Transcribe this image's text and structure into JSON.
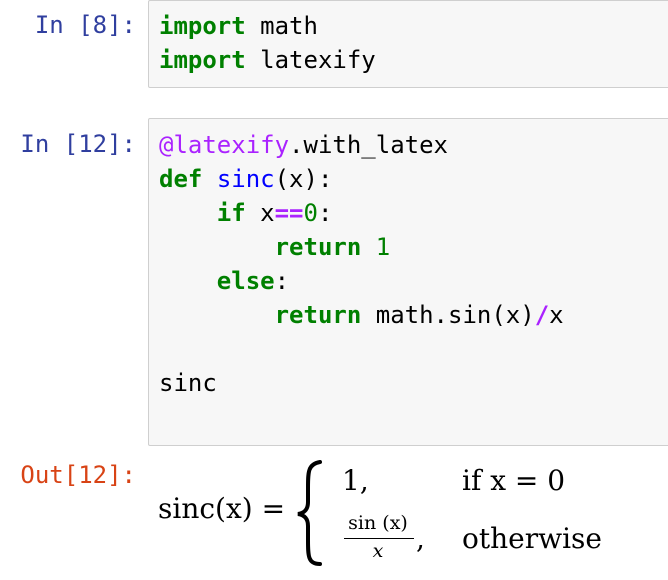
{
  "cells": [
    {
      "prompt": "In [8]:",
      "lines": [
        [
          {
            "t": "import",
            "c": "kw"
          },
          {
            "t": " math"
          }
        ],
        [
          {
            "t": "import",
            "c": "kw"
          },
          {
            "t": " latexify"
          }
        ]
      ]
    },
    {
      "prompt": "In [12]:",
      "lines": [
        [
          {
            "t": "@latexify",
            "c": "dec"
          },
          {
            "t": ".with_latex"
          }
        ],
        [
          {
            "t": "def",
            "c": "kw"
          },
          {
            "t": " "
          },
          {
            "t": "sinc",
            "c": "fn"
          },
          {
            "t": "(x):"
          }
        ],
        [
          {
            "t": "    "
          },
          {
            "t": "if",
            "c": "kw"
          },
          {
            "t": " x"
          },
          {
            "t": "==",
            "c": "op"
          },
          {
            "t": "0",
            "c": "num"
          },
          {
            "t": ":"
          }
        ],
        [
          {
            "t": "        "
          },
          {
            "t": "return",
            "c": "kw"
          },
          {
            "t": " "
          },
          {
            "t": "1",
            "c": "num"
          }
        ],
        [
          {
            "t": "    "
          },
          {
            "t": "else",
            "c": "kw"
          },
          {
            "t": ":"
          }
        ],
        [
          {
            "t": "        "
          },
          {
            "t": "return",
            "c": "kw"
          },
          {
            "t": " math.sin(x)"
          },
          {
            "t": "/",
            "c": "op"
          },
          {
            "t": "x"
          }
        ],
        [],
        [
          {
            "t": "sinc"
          }
        ]
      ]
    }
  ],
  "output": {
    "prompt": "Out[12]:",
    "lhs": "sinc(x) =",
    "case1_value": "1,",
    "case1_cond": "if x = 0",
    "case2_num": "sin (x)",
    "case2_den": "x",
    "case2_comma": ",",
    "case2_cond": "otherwise"
  },
  "colors": {
    "in_prompt": "#303f9f",
    "out_prompt": "#d84315",
    "keyword": "#008000",
    "function": "#0000ff",
    "operator": "#aa22ff"
  }
}
